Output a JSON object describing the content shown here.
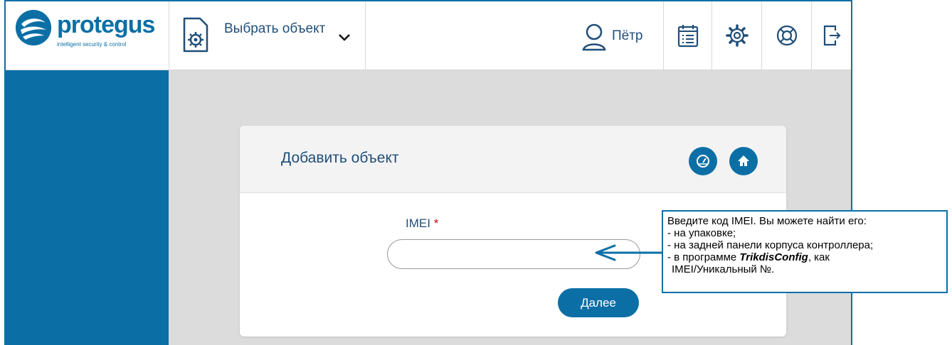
{
  "brand": {
    "name": "protegus",
    "tagline": "intelligent security & control",
    "color": "#0b6fa6"
  },
  "header": {
    "object_selector_label": "Выбрать объект",
    "user_name": "Пётр",
    "icons": [
      "calendar-list-icon",
      "settings-gear-icon",
      "help-lifebuoy-icon",
      "logout-icon"
    ]
  },
  "card": {
    "title": "Добавить объект",
    "imei_label": "IMEI",
    "required_mark": "*",
    "imei_value": "",
    "next_label": "Далее"
  },
  "callout": {
    "line1": "Введите код IMEI. Вы можете найти его:",
    "line2": "- на упаковке;",
    "line3": "- на задней панели корпуса контроллера;",
    "line4_prefix": "- в программе ",
    "line4_bold": "TrikdisConfig",
    "line4_suffix": ", как",
    "line5": "IMEI/Уникальный №."
  },
  "colors": {
    "sidebar": "#0b6fa6",
    "content_bg": "#dcdcdc",
    "accent": "#0b6fa6"
  }
}
